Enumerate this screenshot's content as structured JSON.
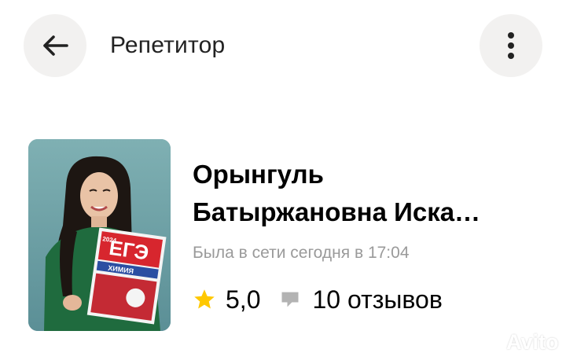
{
  "header": {
    "title": "Репетитор",
    "back_icon": "arrow-left-icon",
    "more_icon": "more-vertical-icon"
  },
  "profile": {
    "name_line1": "Орынгуль",
    "name_line2": "Батыржановна Иска…",
    "online_status": "Была в сети сегодня в 17:04",
    "rating": "5,0",
    "reviews": "10 отзывов",
    "photo_book_title": "ЕГЭ",
    "photo_book_subject": "ХИМИЯ",
    "photo_book_year": "2024"
  },
  "watermark": "Avito",
  "colors": {
    "star": "#ffc800",
    "icon_gray": "#b3b3b3",
    "secondary_text": "#9a9a9a",
    "button_bg": "#f2f1f0"
  }
}
